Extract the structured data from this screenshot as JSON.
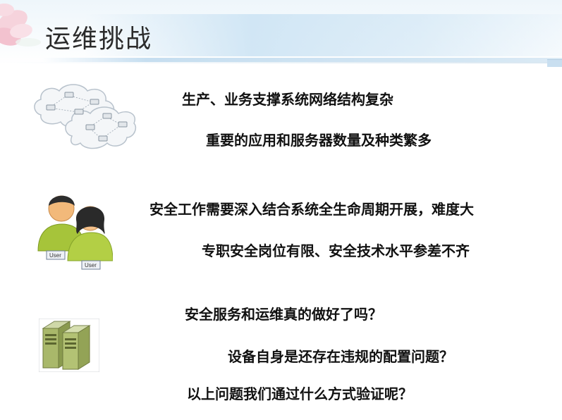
{
  "slide": {
    "title": "运维挑战"
  },
  "points": [
    {
      "text": "生产、业务支撑系统网络结构复杂"
    },
    {
      "text": "重要的应用和服务器数量及种类繁多"
    },
    {
      "text": "安全工作需要深入结合系统全生命周期开展，难度大"
    },
    {
      "text": "专职安全岗位有限、安全技术水平参差不齐"
    },
    {
      "text": "安全服务和运维真的做好了吗？"
    },
    {
      "text": "设备自身是还存在违规的配置问题？"
    },
    {
      "text": "以上问题我们通过什么方式验证呢？"
    }
  ],
  "icons": {
    "network": "network-cloud-icon",
    "users": "users-icon",
    "servers": "servers-icon",
    "user_tag_1": "User",
    "user_tag_2": "User"
  }
}
